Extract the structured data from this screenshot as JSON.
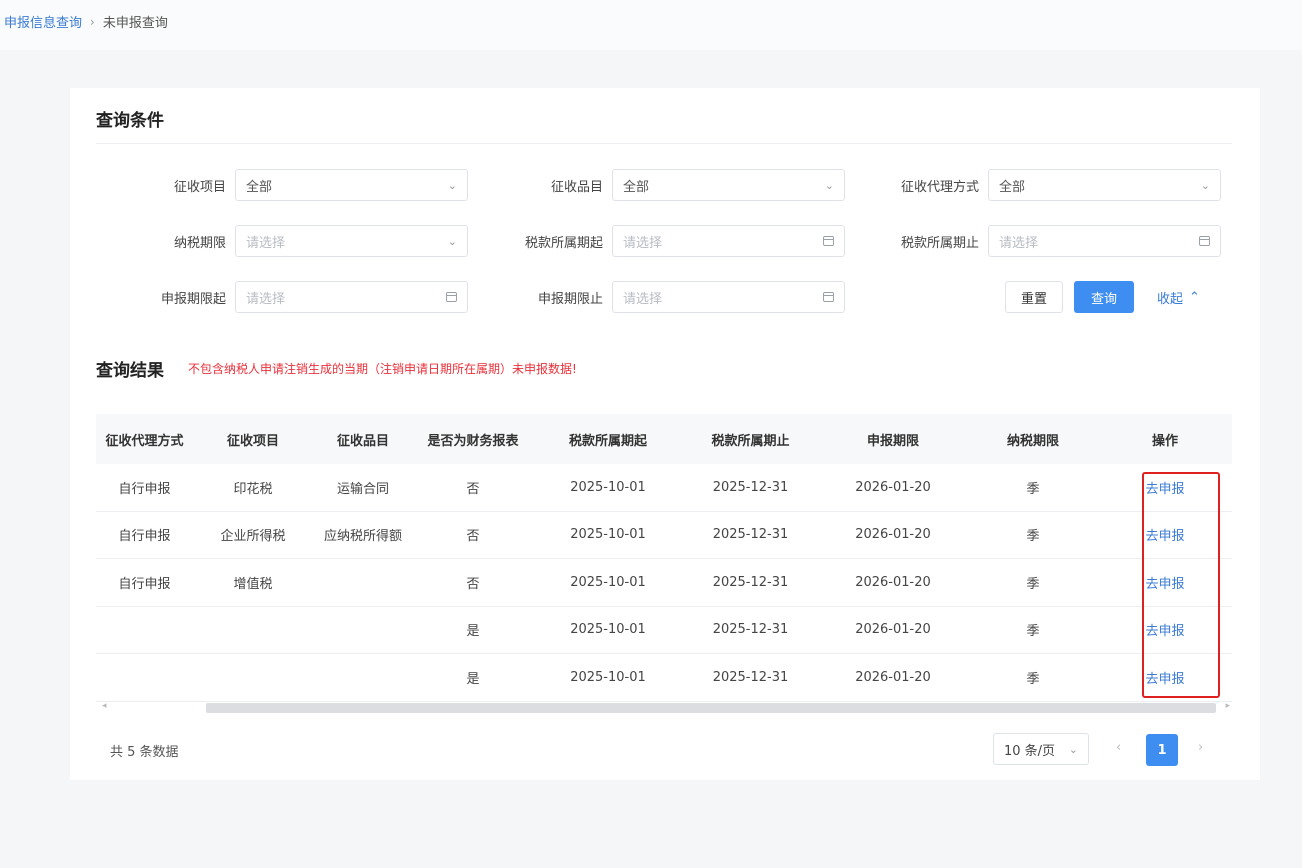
{
  "breadcrumb": {
    "parent": "申报信息查询",
    "separator": "›",
    "current": "未申报查询"
  },
  "query_section": {
    "title": "查询条件",
    "fields": [
      {
        "label": "征收项目",
        "value": "全部",
        "placeholder": ""
      },
      {
        "label": "征收品目",
        "value": "全部",
        "placeholder": ""
      },
      {
        "label": "征收代理方式",
        "value": "全部",
        "placeholder": ""
      },
      {
        "label": "纳税期限",
        "value": "",
        "placeholder": "请选择"
      },
      {
        "label": "税款所属期起",
        "value": "",
        "placeholder": "请选择"
      },
      {
        "label": "税款所属期止",
        "value": "",
        "placeholder": "请选择"
      },
      {
        "label": "申报期限起",
        "value": "",
        "placeholder": "请选择"
      },
      {
        "label": "申报期限止",
        "value": "",
        "placeholder": "请选择"
      }
    ],
    "reset_label": "重置",
    "query_label": "查询",
    "collapse_label": "收起"
  },
  "results": {
    "title": "查询结果",
    "warning": "不包含纳税人申请注销生成的当期（注销申请日期所在属期）未申报数据!",
    "columns": [
      "征收代理方式",
      "征收项目",
      "征收品目",
      "是否为财务报表",
      "税款所属期起",
      "税款所属期止",
      "申报期限",
      "纳税期限",
      "操作"
    ],
    "rows": [
      [
        "自行申报",
        "印花税",
        "运输合同",
        "否",
        "2025-10-01",
        "2025-12-31",
        "2026-01-20",
        "季",
        "去申报"
      ],
      [
        "自行申报",
        "企业所得税",
        "应纳税所得额",
        "否",
        "2025-10-01",
        "2025-12-31",
        "2026-01-20",
        "季",
        "去申报"
      ],
      [
        "自行申报",
        "增值税",
        "",
        "否",
        "2025-10-01",
        "2025-12-31",
        "2026-01-20",
        "季",
        "去申报"
      ],
      [
        "",
        "",
        "",
        "是",
        "2025-10-01",
        "2025-12-31",
        "2026-01-20",
        "季",
        "去申报"
      ],
      [
        "",
        "",
        "",
        "是",
        "2025-10-01",
        "2025-12-31",
        "2026-01-20",
        "季",
        "去申报"
      ]
    ]
  },
  "pagination": {
    "total_text": "共 5 条数据",
    "page_size": "10 条/页",
    "current_page": "1",
    "prev": "‹",
    "next": "›"
  },
  "colors": {
    "accent": "#3d8ef0",
    "warning": "#e8303a",
    "highlight_box": "#e02020"
  }
}
